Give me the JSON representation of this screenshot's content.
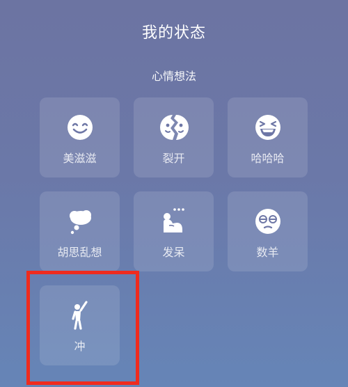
{
  "header": {
    "title": "我的状态",
    "section_title": "心情想法"
  },
  "status_options": [
    {
      "label": "美滋滋",
      "icon": "smiley-face-icon"
    },
    {
      "label": "裂开",
      "icon": "cracked-face-icon"
    },
    {
      "label": "哈哈哈",
      "icon": "laughing-face-icon"
    },
    {
      "label": "胡思乱想",
      "icon": "thought-bubble-icon"
    },
    {
      "label": "发呆",
      "icon": "daydreaming-person-icon"
    },
    {
      "label": "数羊",
      "icon": "sleepy-face-icon"
    },
    {
      "label": "冲",
      "icon": "cheering-person-icon"
    }
  ],
  "colors": {
    "highlight_border": "#ef2b1e",
    "background": "#6c74a2"
  }
}
